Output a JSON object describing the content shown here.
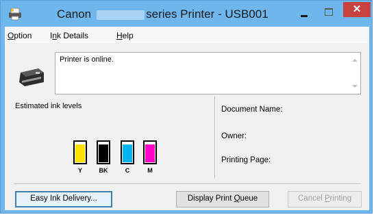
{
  "window": {
    "title_prefix": "Canon",
    "title_suffix": "series Printer - USB001",
    "close_glyph": "✕",
    "accent_color": "#6fb6ec",
    "close_color": "#c8413e"
  },
  "menu": {
    "items": [
      {
        "label_u": "O",
        "label_rest": "ption"
      },
      {
        "label_pre": "I",
        "label_u": "n",
        "label_rest": "k Details"
      },
      {
        "label_u": "H",
        "label_rest": "elp"
      }
    ]
  },
  "status": {
    "text": "Printer is online."
  },
  "ink": {
    "label": "Estimated ink levels",
    "tanks": [
      {
        "letter": "Y",
        "color": "#ffe000",
        "level": 0.9
      },
      {
        "letter": "BK",
        "color": "#000000",
        "level": 0.9
      },
      {
        "letter": "C",
        "color": "#00b4f0",
        "level": 0.9
      },
      {
        "letter": "M",
        "color": "#ff00c8",
        "level": 0.9
      }
    ]
  },
  "job": {
    "document_label": "Document Name:",
    "owner_label": "Owner:",
    "page_label": "Printing Page:"
  },
  "buttons": {
    "easy_ink": "Easy Ink Delivery...",
    "queue_pre": "Display Print ",
    "queue_u": "Q",
    "queue_rest": "ueue",
    "cancel_pre": "Cancel ",
    "cancel_u": "P",
    "cancel_rest": "rinting"
  }
}
